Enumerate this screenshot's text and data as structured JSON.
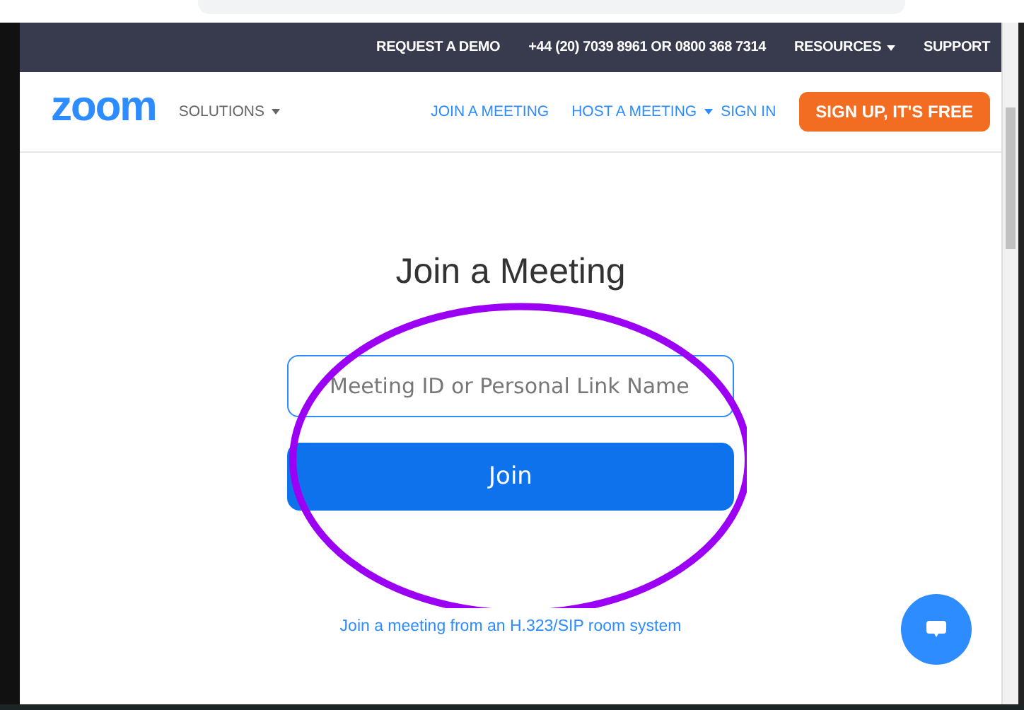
{
  "top_bar": {
    "links": [
      {
        "label": "REQUEST A DEMO",
        "kind": "link"
      },
      {
        "label": "+44 (20) 7039 8961 OR 0800 368 7314",
        "kind": "link"
      },
      {
        "label": "RESOURCES",
        "kind": "menu"
      },
      {
        "label": "SUPPORT",
        "kind": "link"
      }
    ]
  },
  "header": {
    "logo": "zoom",
    "solutions": "SOLUTIONS",
    "nav": [
      {
        "label": "JOIN A MEETING",
        "has_menu": false
      },
      {
        "label": "HOST A MEETING",
        "has_menu": true
      },
      {
        "label": "SIGN IN",
        "has_menu": false
      }
    ],
    "cta": "SIGN UP, IT'S FREE"
  },
  "main": {
    "title": "Join a Meeting",
    "field": {
      "placeholder": "Meeting ID or Personal Link Name"
    },
    "button": "Join",
    "link": "Join a meeting from an H.323/SIP room system"
  }
}
